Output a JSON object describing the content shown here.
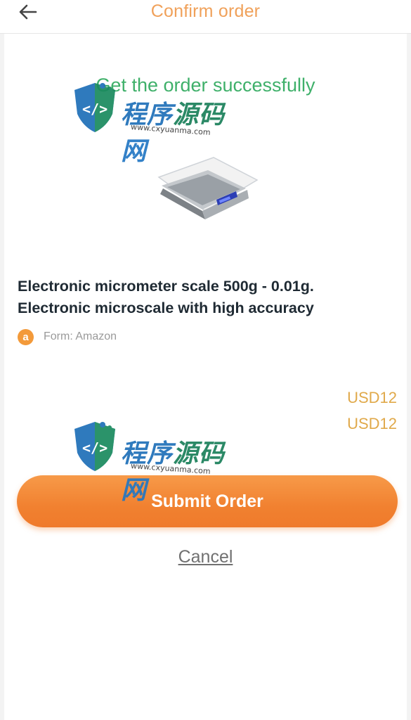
{
  "header": {
    "title": "Confirm order"
  },
  "status": {
    "message": "Get the order successfully"
  },
  "product": {
    "title_line1": "Electronic micrometer scale 500g - 0.01g.",
    "title_line2": "Electronic microscale with high accuracy",
    "source_icon_letter": "a",
    "source_text": "Form: Amazon"
  },
  "prices": {
    "line1": "USD12",
    "line2": "USD12"
  },
  "actions": {
    "submit_label": "Submit Order",
    "cancel_label": "Cancel"
  },
  "watermark": {
    "chars": [
      "程",
      "序",
      "源",
      "码",
      "网"
    ],
    "url": "www.cxyuanma.com"
  },
  "colors": {
    "title_orange": "#f0a15a",
    "success_green": "#3fb06a",
    "price_gold": "#e0a94a",
    "button_orange": "#f18130"
  },
  "icons": {
    "back": "arrow-left-icon",
    "source": "amazon-icon",
    "watermark_logo": "code-shield-icon"
  }
}
